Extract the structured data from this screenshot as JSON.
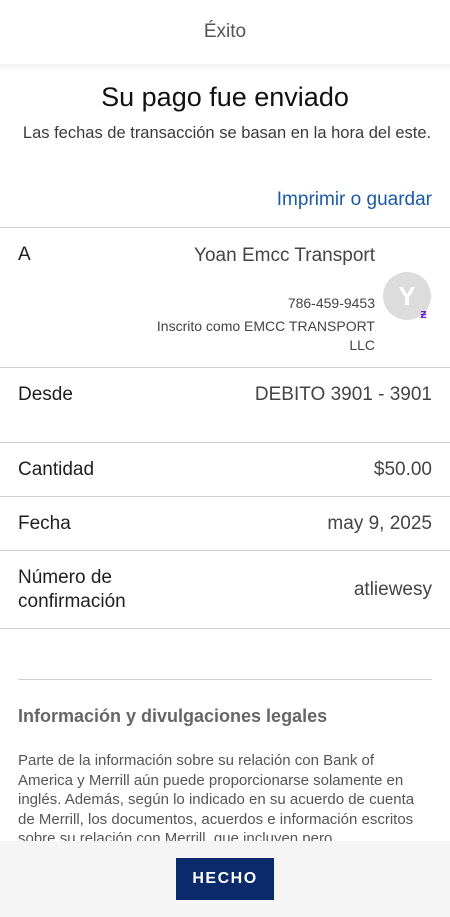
{
  "header": {
    "title": "Éxito"
  },
  "confirmation": {
    "headline": "Su pago fue enviado",
    "subtext": "Las fechas de transacción se basan en la hora del este.",
    "print_link": "Imprimir o guardar"
  },
  "details": {
    "to": {
      "label": "A",
      "name": "Yoan Emcc Transport",
      "phone": "786-459-9453",
      "enrolled_as": "Inscrito como EMCC TRANSPORT LLC",
      "avatar_initial": "Y",
      "badge_icon": "zelle-icon",
      "badge_glyph": "ƶ"
    },
    "from": {
      "label": "Desde",
      "value": "DEBITO 3901 - 3901"
    },
    "amount": {
      "label": "Cantidad",
      "value": "$50.00"
    },
    "date": {
      "label": "Fecha",
      "value": "may 9, 2025"
    },
    "confirmation_number": {
      "label": "Número de confirmación",
      "value": "atliewesy"
    }
  },
  "legal": {
    "title": "Información y divulgaciones legales",
    "body": "Parte de la información sobre su relación con Bank of America y Merrill aún puede proporcionarse solamente en inglés. Además, según lo indicado en su acuerdo de cuenta de Merrill, los documentos, acuerdos e información escritos sobre su relación con Merrill, que incluyen pero"
  },
  "footer": {
    "done_label": "HECHO"
  },
  "colors": {
    "link": "#1a5aa6",
    "primary_button": "#0a2a6b",
    "zelle_purple": "#6d1ed4"
  }
}
